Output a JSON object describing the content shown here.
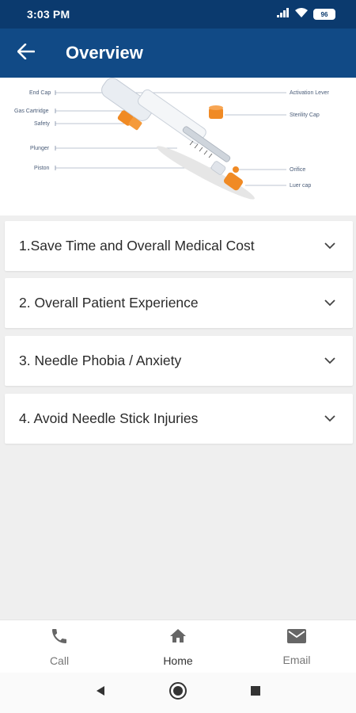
{
  "status_bar": {
    "time": "3:03 PM",
    "battery": "96"
  },
  "app_bar": {
    "title": "Overview"
  },
  "diagram": {
    "labels_left": [
      "End Cap",
      "Gas Cartridge",
      "Safety",
      "Plunger",
      "Piston"
    ],
    "labels_right": [
      "Activation Lever",
      "Sterility Cap",
      "Orifice",
      "Luer cap"
    ]
  },
  "accordion": [
    {
      "label": "1.Save Time and Overall Medical Cost"
    },
    {
      "label": "2. Overall Patient Experience"
    },
    {
      "label": "3. Needle Phobia / Anxiety"
    },
    {
      "label": "4. Avoid Needle Stick Injuries"
    }
  ],
  "bottom_nav": [
    {
      "label": "Call",
      "icon": "phone-icon"
    },
    {
      "label": "Home",
      "icon": "home-icon"
    },
    {
      "label": "Email",
      "icon": "mail-icon"
    }
  ],
  "colors": {
    "status_bar": "#0b3a6e",
    "app_bar": "#114a86",
    "accent_orange": "#f08a24",
    "background": "#efefef"
  }
}
